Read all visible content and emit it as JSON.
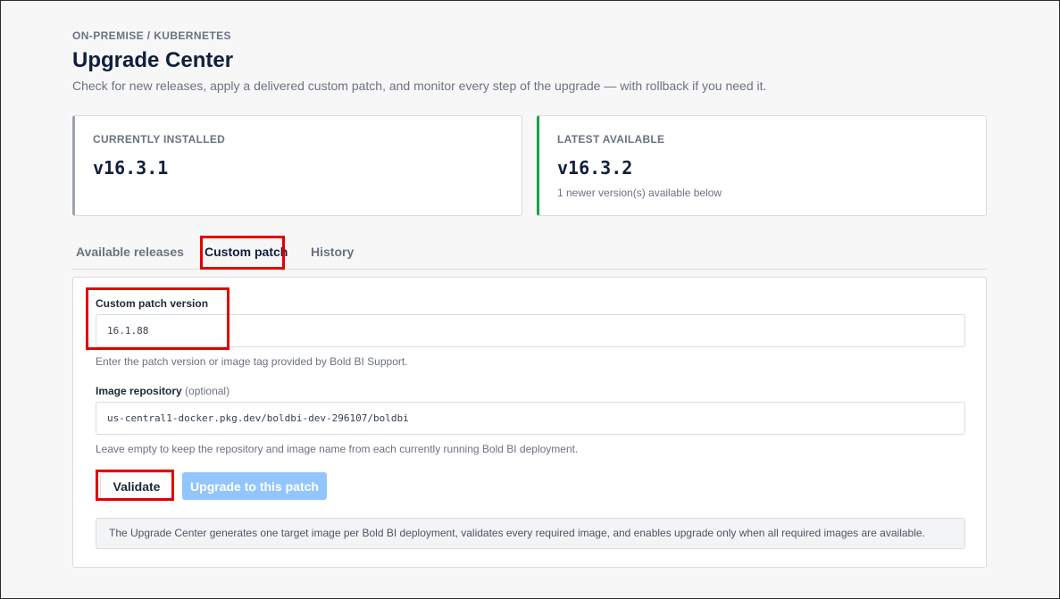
{
  "header": {
    "breadcrumb": "ON-PREMISE / KUBERNETES",
    "title": "Upgrade Center",
    "subtitle": "Check for new releases, apply a delivered custom patch, and monitor every step of the upgrade — with rollback if you need it."
  },
  "cards": {
    "installed": {
      "label": "CURRENTLY INSTALLED",
      "version": "v16.3.1"
    },
    "latest": {
      "label": "LATEST AVAILABLE",
      "version": "v16.3.2",
      "note": "1 newer version(s) available below"
    }
  },
  "tabs": [
    {
      "label": "Available releases"
    },
    {
      "label": "Custom patch",
      "active": true
    },
    {
      "label": "History"
    }
  ],
  "form": {
    "patch_version": {
      "label": "Custom patch version",
      "value": "16.1.88",
      "help": "Enter the patch version or image tag provided by Bold BI Support."
    },
    "image_repo": {
      "label": "Image repository",
      "optional": "(optional)",
      "value": "us-central1-docker.pkg.dev/boldbi-dev-296107/boldbi",
      "help": "Leave empty to keep the repository and image name from each currently running Bold BI deployment."
    },
    "validate_label": "Validate",
    "upgrade_label": "Upgrade to this patch",
    "notice": "The Upgrade Center generates one target image per Bold BI deployment, validates every required image, and enables upgrade only when all required images are available."
  },
  "colors": {
    "accent_green": "#16a34a",
    "highlight_red": "#e30000",
    "upgrade_disabled_blue": "#93c5fd",
    "title_navy": "#0f1f3d"
  }
}
